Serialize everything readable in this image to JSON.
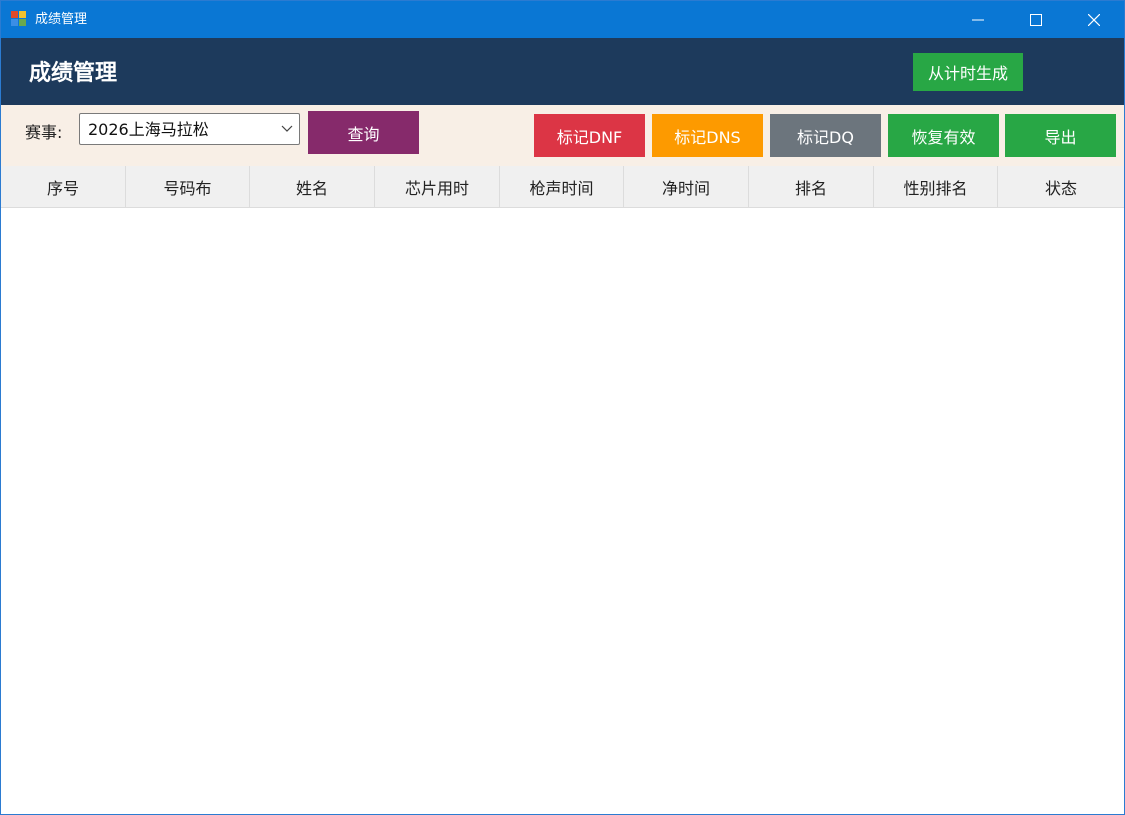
{
  "window": {
    "title": "成绩管理",
    "controls": [
      "minimize-icon",
      "maximize-icon",
      "close-icon"
    ]
  },
  "header": {
    "title": "成绩管理",
    "generate_button": "从计时生成"
  },
  "filter": {
    "race_label": "赛事:",
    "race_selected": "2026上海马拉松",
    "query_button": "查询"
  },
  "actions": {
    "mark_dnf": "标记DNF",
    "mark_dns": "标记DNS",
    "mark_dq": "标记DQ",
    "restore": "恢复有效",
    "export": "导出"
  },
  "table": {
    "columns": [
      "序号",
      "号码布",
      "姓名",
      "芯片用时",
      "枪声时间",
      "净时间",
      "排名",
      "性别排名",
      "状态"
    ],
    "rows": []
  },
  "colors": {
    "titlebar": "#0a77d4",
    "header": "#1d3a5c",
    "toolbar": "#f8efe6",
    "generate": "#28a745",
    "query": "#862a6b",
    "dnf": "#dc3545",
    "dns": "#fd9a00",
    "dq": "#6c757d",
    "restore": "#28a745",
    "export": "#28a745"
  }
}
